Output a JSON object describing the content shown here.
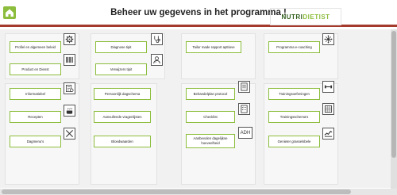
{
  "header": {
    "title": "Beheer uw gegevens in het programma !",
    "logo_pre": "NUTRI",
    "logo_accent": "DIETIST"
  },
  "colors": {
    "accent": "#8cbd3c",
    "header_rule": "#a43a2c"
  },
  "buttons": {
    "profiel": "Profiel en algemeen beleid",
    "product": "Product en Dienst",
    "diagnose": "Diagnose tipit",
    "verwijzers": "Verwijzers tipit",
    "tailor": "Tailor made rapport apttiove",
    "coaching": "Programma e-coaching",
    "informatiebel": "Informatiebel",
    "recepten": "Recepten",
    "dagmenu": "Dagmenu's",
    "dagschema": "Persoonlijk dagschema",
    "opgemijdzaam": "Aanvullende vragenlijsten",
    "bloedwaarden": "Bloedwaarden",
    "behandelplan": "Behandelplan protocol",
    "checklist": "Checklist",
    "aanbevolen": "Aanbevolen dagelijkse hoeveelheid",
    "trainingsoefeningen": "Trainingsoefeningen",
    "trainingsschema": "Trainingsschema's",
    "genieter": "Genieter grasselsbele"
  },
  "icons": {
    "gear": "gear-icon",
    "barcode": "barcode-icon",
    "stethoscope": "stethoscope-icon",
    "doctor": "doctor-icon",
    "network": "network-icon",
    "info": "info-icon",
    "cooking": "cooking-icon",
    "cutlery": "cutlery-icon",
    "notebook": "notebook-icon",
    "checklist": "checklist-icon",
    "adh_label": "ADH",
    "dumbbell": "dumbbell-icon",
    "schedule": "schedule-icon",
    "running": "running-icon"
  }
}
